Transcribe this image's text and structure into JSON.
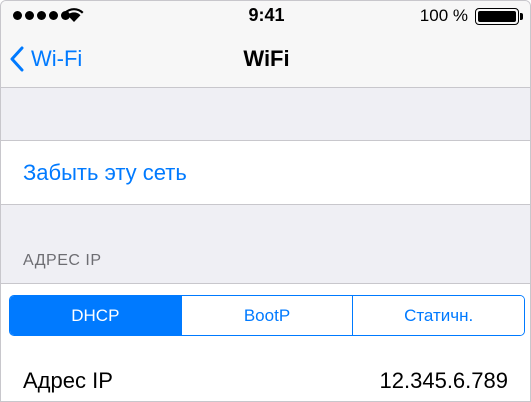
{
  "status_bar": {
    "signal_dots": 5,
    "wifi_icon": "wifi-icon",
    "time": "9:41",
    "battery_percent": "100 %",
    "battery_level": 1.0
  },
  "nav": {
    "back_label": "Wi-Fi",
    "back_icon": "chevron-left-icon",
    "title": "WiFi"
  },
  "actions": {
    "forget_label": "Забыть эту сеть"
  },
  "ip_section": {
    "header": "АДРЕС IP",
    "segments": [
      "DHCP",
      "BootP",
      "Статичн."
    ],
    "selected_segment": "DHCP",
    "rows": [
      {
        "label": "Адрес IP",
        "value": "12.345.6.789"
      }
    ]
  },
  "colors": {
    "accent": "#007aff",
    "background": "#efeff4",
    "separator": "#c8c7cc",
    "section_header": "#6d6d72"
  }
}
